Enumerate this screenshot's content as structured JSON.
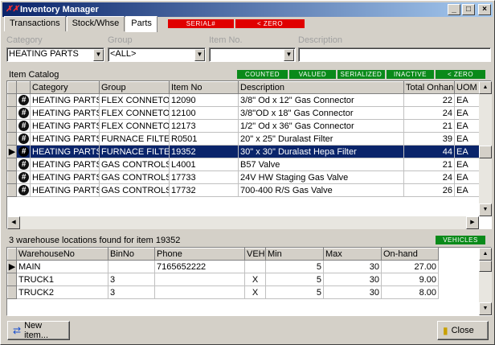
{
  "window": {
    "title": "Inventory Manager"
  },
  "tabs": [
    {
      "label": "Transactions"
    },
    {
      "label": "Stock/Whse"
    },
    {
      "label": "Parts"
    }
  ],
  "badges_top": {
    "serial": "SERIAL#",
    "zero": "< ZERO"
  },
  "filters": {
    "category_label": "Category",
    "group_label": "Group",
    "itemno_label": "Item No.",
    "description_label": "Description",
    "category_value": "HEATING PARTS",
    "group_value": "<ALL>",
    "itemno_value": "",
    "description_value": ""
  },
  "catalog": {
    "title": "Item Catalog",
    "badges": [
      "COUNTED",
      "VALUED",
      "SERIALIZED",
      "INACTIVE",
      "< ZERO"
    ],
    "columns": [
      "Category",
      "Group",
      "Item No",
      "Description",
      "Total Onhand",
      "UOM"
    ],
    "rows": [
      {
        "category": "HEATING PARTS",
        "group": "FLEX CONNETORS",
        "item": "12090",
        "desc": "3/8\" Od x 12\" Gas Connector",
        "onhand": "22",
        "uom": "EA"
      },
      {
        "category": "HEATING PARTS",
        "group": "FLEX CONNETORS",
        "item": "12100",
        "desc": "3/8\"OD x 18\" Gas Connector",
        "onhand": "24",
        "uom": "EA"
      },
      {
        "category": "HEATING PARTS",
        "group": "FLEX CONNETORS",
        "item": "12173",
        "desc": "1/2\" Od x 36\" Gas Connector",
        "onhand": "21",
        "uom": "EA"
      },
      {
        "category": "HEATING PARTS",
        "group": "FURNACE FILTERS",
        "item": "R0501",
        "desc": "20\" x 25\" Duralast Filter",
        "onhand": "39",
        "uom": "EA"
      },
      {
        "category": "HEATING PARTS",
        "group": "FURNACE FILTERS",
        "item": "19352",
        "desc": "30\" x 30\" Duralast Hepa Filter",
        "onhand": "44",
        "uom": "EA"
      },
      {
        "category": "HEATING PARTS",
        "group": "GAS CONTROLS",
        "item": "L4001",
        "desc": "B57 Valve",
        "onhand": "21",
        "uom": "EA"
      },
      {
        "category": "HEATING PARTS",
        "group": "GAS CONTROLS",
        "item": "17733",
        "desc": "24V HW Staging Gas Valve",
        "onhand": "24",
        "uom": "EA"
      },
      {
        "category": "HEATING PARTS",
        "group": "GAS CONTROLS",
        "item": "17732",
        "desc": "700-400 R/S Gas Valve",
        "onhand": "26",
        "uom": "EA"
      }
    ]
  },
  "warehouse": {
    "status": "3 warehouse locations found for item 19352",
    "badge": "VEHICLES",
    "columns": [
      "WarehouseNo",
      "BinNo",
      "Phone",
      "VEH",
      "Min",
      "Max",
      "On-hand"
    ],
    "rows": [
      {
        "wh": "MAIN",
        "bin": "",
        "phone": "7165652222",
        "veh": "",
        "min": "5",
        "max": "30",
        "onhand": "27.00"
      },
      {
        "wh": "TRUCK1",
        "bin": "3",
        "phone": "",
        "veh": "X",
        "min": "5",
        "max": "30",
        "onhand": "9.00"
      },
      {
        "wh": "TRUCK2",
        "bin": "3",
        "phone": "",
        "veh": "X",
        "min": "5",
        "max": "30",
        "onhand": "8.00"
      }
    ]
  },
  "buttons": {
    "new_item": "New item...",
    "close": "Close"
  },
  "icons": {
    "row_marker": "hash-icon",
    "current_row": "row-pointer-icon"
  }
}
